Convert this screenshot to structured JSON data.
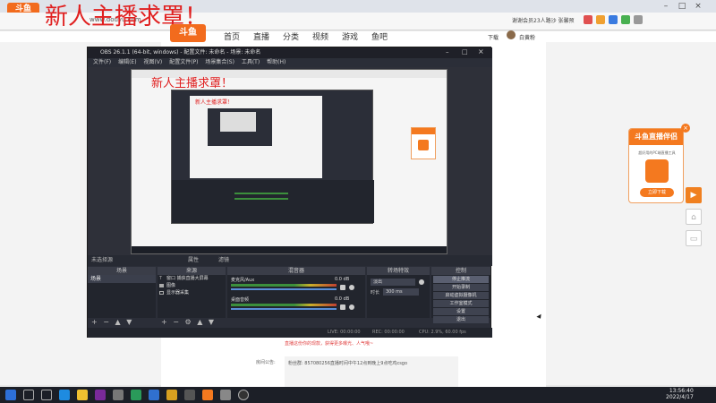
{
  "browser": {
    "title_overlay": "新人主播求罩！",
    "url": "www.douyu.com",
    "address_right": "谢谢会员23人路沙 张馨预",
    "site_logo": "斗鱼"
  },
  "nav": {
    "items": [
      "首页",
      "直播",
      "分类",
      "视频",
      "游戏",
      "鱼吧"
    ],
    "download": "下载",
    "user": "白黄粉"
  },
  "obs": {
    "title": "OBS 26.1.1 (64-bit, windows) - 配置文件: 未命名 - 场景: 未命名",
    "menu": [
      "文件(F)",
      "编辑(E)",
      "视图(V)",
      "配置文件(P)",
      "场景集合(S)",
      "工具(T)",
      "帮助(H)"
    ],
    "no_source": "未选择源",
    "props_btn": "属性",
    "filters_btn": "滤镜",
    "docks": {
      "scenes": "场景",
      "sources": "来源",
      "mixer": "混音器",
      "transitions": "转场特效",
      "controls": "控制"
    },
    "scene_list": [
      "场景"
    ],
    "source_list": [
      "窗口 捕获直播大屏幕",
      "图像",
      "显示器采集"
    ],
    "mixer_tracks": [
      {
        "name": "麦克风/Aux",
        "db": "0.0 dB"
      },
      {
        "name": "桌面音频",
        "db": "0.0 dB"
      }
    ],
    "transition": {
      "type": "淡出",
      "duration_label": "时长",
      "duration": "300 ms"
    },
    "controls": [
      "停止推流",
      "开始录制",
      "启动虚拟摄像机",
      "工作室模式",
      "设置",
      "退出"
    ],
    "status": {
      "live": "LIVE: 00:00:00",
      "rec": "REC: 00:00:00",
      "cpu": "CPU: 2.9%, 60.00 fps"
    }
  },
  "promo": {
    "title": "斗鱼直播伴侣",
    "subtitle": "超好用的PC端直播工具",
    "button": "立即下载"
  },
  "page": {
    "note": "直播这份你的现款，获得更多曝光、人气哦~",
    "announce_label": "房间公告:",
    "announce_text": "粉丝群: 857080256直播时间中午12点到晚上9点吃鸡csgo"
  },
  "taskbar": {
    "time": "13:56:40",
    "date": "2022/4/17"
  },
  "colors": {
    "douyu_orange": "#f4791f",
    "obs_dark": "#2b2e38",
    "title_red": "#e02020"
  }
}
